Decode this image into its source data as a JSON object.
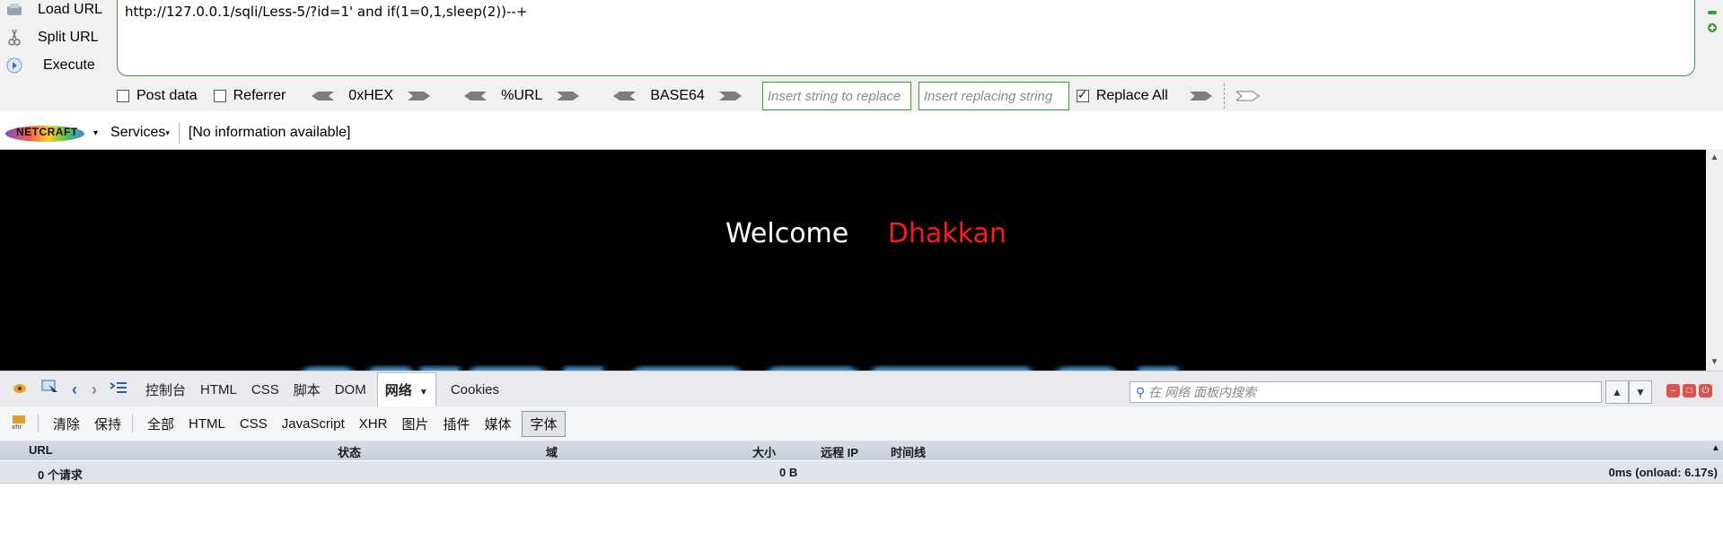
{
  "hackbar": {
    "load_url": "Load URL",
    "split_url": "Split URL",
    "execute": "Execute",
    "url_value": "http://127.0.0.1/sqli/Less-5/?id=1' and if(1=0,1,sleep(2))--+",
    "post_data": "Post data",
    "referrer": "Referrer",
    "hex": "0xHEX",
    "url_enc": "%URL",
    "base64": "BASE64",
    "replace_placeholder": "Insert string to replace",
    "replacing_placeholder": "Insert replacing string",
    "replace_all": "Replace All",
    "replace_all_checked": true,
    "post_data_checked": false,
    "referrer_checked": false
  },
  "netcraft": {
    "logo": "NETCRAFT",
    "services": "Services",
    "info": "[No information available]"
  },
  "page": {
    "welcome": "Welcome",
    "name": "Dhakkan",
    "name_color": "#ff1a1a"
  },
  "firebug": {
    "tabs": [
      "控制台",
      "HTML",
      "CSS",
      "脚本",
      "DOM",
      "网络",
      "Cookies"
    ],
    "active_tab": "网络",
    "search_placeholder": "在 网络 面板内搜索",
    "filter_clear": "清除",
    "filter_keep": "保持",
    "filters": [
      "全部",
      "HTML",
      "CSS",
      "JavaScript",
      "XHR",
      "图片",
      "插件",
      "媒体",
      "字体"
    ],
    "active_filter": "字体",
    "columns": {
      "url": "URL",
      "status": "状态",
      "domain": "域",
      "size": "大小",
      "remote_ip": "远程 IP",
      "timeline": "时间线"
    },
    "summary": {
      "requests": "0 个请求",
      "size": "0 B",
      "timing": "0ms (onload: 6.17s)"
    }
  }
}
